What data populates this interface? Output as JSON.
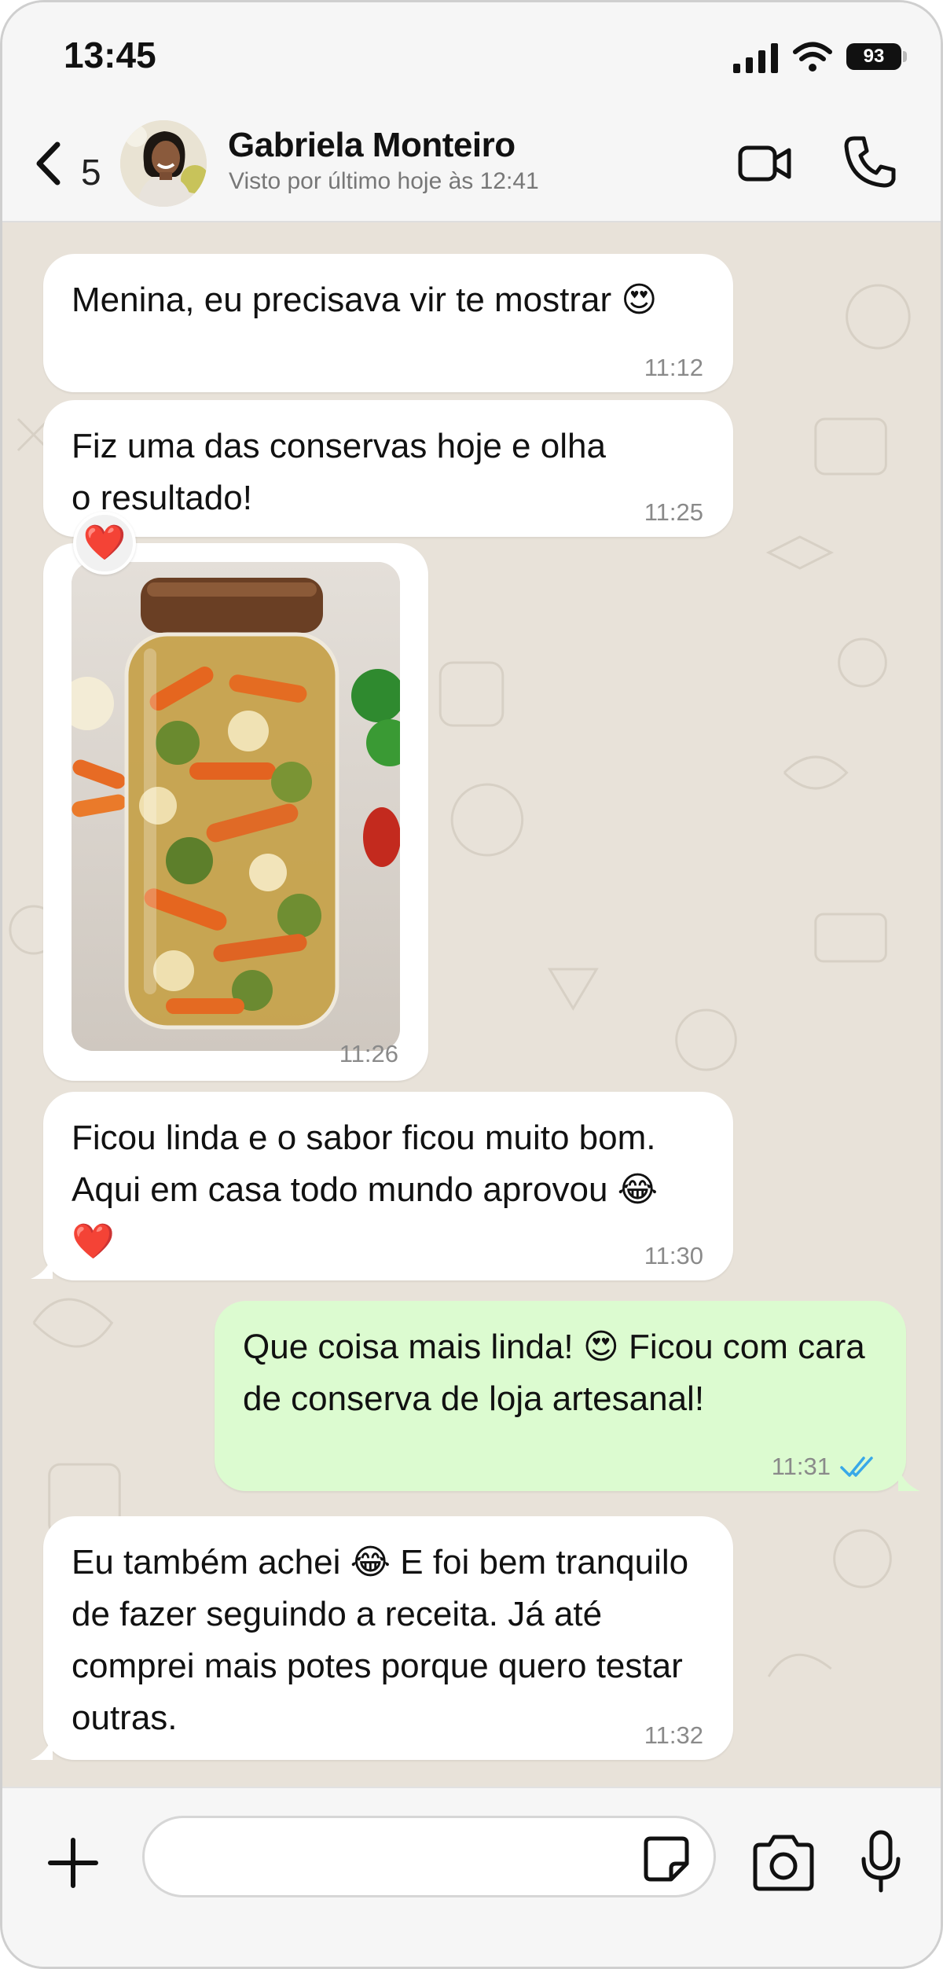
{
  "status_bar": {
    "time": "13:45",
    "battery": "93"
  },
  "header": {
    "unread_count": "5",
    "contact_name": "Gabriela Monteiro",
    "last_seen": "Visto por último hoje às 12:41"
  },
  "messages": [
    {
      "direction": "incoming",
      "text": "Menina, eu precisava vir te mostrar 😍",
      "time": "11:12"
    },
    {
      "direction": "incoming",
      "text": "Fiz uma das conservas hoje e olha o resultado!",
      "time": "11:25"
    },
    {
      "direction": "incoming",
      "type": "image",
      "image_subject": "glass jar of pickled vegetables",
      "reaction": "❤️",
      "time": "11:26"
    },
    {
      "direction": "incoming",
      "text": "Ficou linda e o sabor ficou muito bom. Aqui em casa todo mundo aprovou 😂 ❤️",
      "time": "11:30"
    },
    {
      "direction": "outgoing",
      "text": "Que coisa mais linda! 😍 Ficou com cara de conserva de loja artesanal!",
      "time": "11:31",
      "status": "read"
    },
    {
      "direction": "incoming",
      "text": "Eu também achei 😂 E foi bem tranquilo de fazer seguindo a receita. Já até comprei mais potes porque quero testar outras.",
      "time": "11:32"
    }
  ],
  "composer": {
    "placeholder": ""
  },
  "colors": {
    "chat_background": "#e8e2d9",
    "incoming_bubble": "#ffffff",
    "outgoing_bubble": "#dcfbd0",
    "read_ticks": "#38a8e8"
  },
  "icons": [
    "back-chevron-icon",
    "video-call-icon",
    "phone-icon",
    "plus-icon",
    "sticker-icon",
    "camera-icon",
    "microphone-icon",
    "signal-icon",
    "wifi-icon",
    "read-ticks-icon"
  ]
}
